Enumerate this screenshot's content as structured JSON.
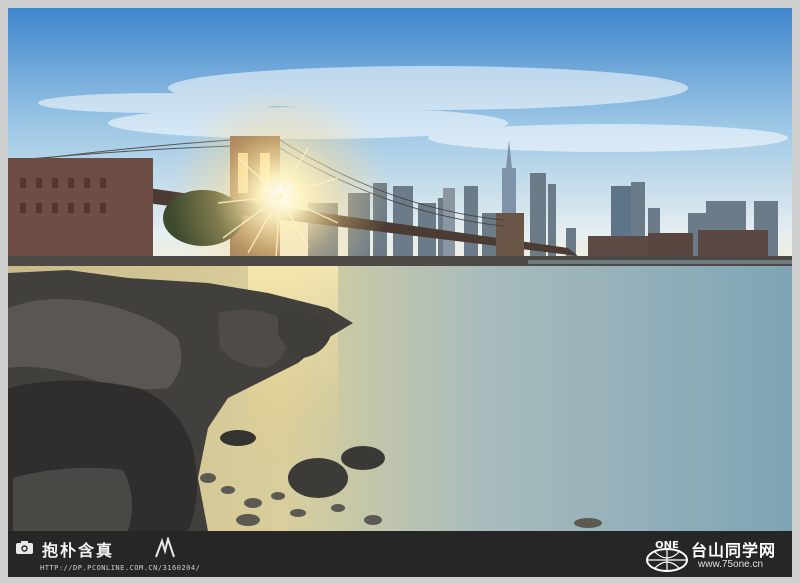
{
  "photo": {
    "subject": "brooklyn-bridge-sunset-long-exposure"
  },
  "watermark": {
    "signature_text": "抱朴含真",
    "signature_url": "HTTP://DP.PCONLINE.COM.CN/3160204/",
    "brand_logo_text": "ONE",
    "brand_name": "台山同学网",
    "brand_url": "www.75one.cn"
  },
  "colors": {
    "sky_top": "#4c8fd0",
    "sky_horizon": "#dfe9ee",
    "water": "#8fb0b8",
    "sun": "#fff6c8",
    "bar": "#262626"
  }
}
